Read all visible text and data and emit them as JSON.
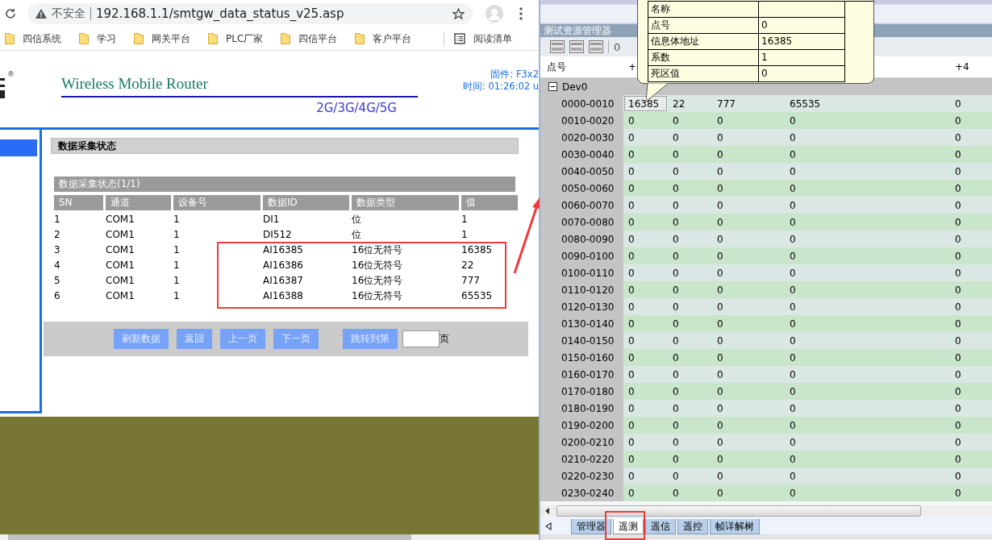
{
  "browser": {
    "security_label": "不安全",
    "url": "192.168.1.1/smtgw_data_status_v25.asp",
    "bookmarks": [
      "四信系统",
      "学习",
      "网关平台",
      "PLC厂家",
      "四信平台",
      "客户平台"
    ],
    "reading_list": "阅读清单"
  },
  "router_page": {
    "logo_mark": "®",
    "brand": "Wireless Mobile Router",
    "bands": "2G/3G/4G/5G",
    "firmware": "固件: F3x2",
    "time": "时间: 01:26:02 u",
    "section_title": "数据采集状态",
    "table_title": "数据采集状态(1/1)",
    "columns": [
      "SN",
      "通道",
      "设备号",
      "数据ID",
      "数据类型",
      "值"
    ],
    "rows": [
      [
        "1",
        "COM1",
        "1",
        "DI1",
        "位",
        "1"
      ],
      [
        "2",
        "COM1",
        "1",
        "DI512",
        "位",
        "1"
      ],
      [
        "3",
        "COM1",
        "1",
        "AI16385",
        "16位无符号",
        "16385"
      ],
      [
        "4",
        "COM1",
        "1",
        "AI16386",
        "16位无符号",
        "22"
      ],
      [
        "5",
        "COM1",
        "1",
        "AI16387",
        "16位无符号",
        "777"
      ],
      [
        "6",
        "COM1",
        "1",
        "AI16388",
        "16位无符号",
        "65535"
      ]
    ],
    "buttons": [
      "刷新数据",
      "返回",
      "上一页",
      "下一页",
      "跳转到第"
    ],
    "page_suffix": "页"
  },
  "tester": {
    "panel_title": "测试资源管理器",
    "toolbar_text": "0",
    "columns": [
      "点号",
      "+",
      "+4"
    ],
    "group": "Dev0",
    "rows": [
      {
        "range": "0000-0010",
        "values": [
          "16385",
          "22",
          "777",
          "65535",
          "0"
        ],
        "focused": true
      },
      {
        "range": "0010-0020",
        "values": [
          "0",
          "0",
          "0",
          "0",
          "0"
        ],
        "focused": false
      },
      {
        "range": "0020-0030",
        "values": [
          "0",
          "0",
          "0",
          "0",
          "0"
        ],
        "focused": false
      },
      {
        "range": "0030-0040",
        "values": [
          "0",
          "0",
          "0",
          "0",
          "0"
        ],
        "focused": false
      },
      {
        "range": "0040-0050",
        "values": [
          "0",
          "0",
          "0",
          "0",
          "0"
        ],
        "focused": false
      },
      {
        "range": "0050-0060",
        "values": [
          "0",
          "0",
          "0",
          "0",
          "0"
        ],
        "focused": false
      },
      {
        "range": "0060-0070",
        "values": [
          "0",
          "0",
          "0",
          "0",
          "0"
        ],
        "focused": false
      },
      {
        "range": "0070-0080",
        "values": [
          "0",
          "0",
          "0",
          "0",
          "0"
        ],
        "focused": false
      },
      {
        "range": "0080-0090",
        "values": [
          "0",
          "0",
          "0",
          "0",
          "0"
        ],
        "focused": false
      },
      {
        "range": "0090-0100",
        "values": [
          "0",
          "0",
          "0",
          "0",
          "0"
        ],
        "focused": false
      },
      {
        "range": "0100-0110",
        "values": [
          "0",
          "0",
          "0",
          "0",
          "0"
        ],
        "focused": false
      },
      {
        "range": "0110-0120",
        "values": [
          "0",
          "0",
          "0",
          "0",
          "0"
        ],
        "focused": false
      },
      {
        "range": "0120-0130",
        "values": [
          "0",
          "0",
          "0",
          "0",
          "0"
        ],
        "focused": false
      },
      {
        "range": "0130-0140",
        "values": [
          "0",
          "0",
          "0",
          "0",
          "0"
        ],
        "focused": false
      },
      {
        "range": "0140-0150",
        "values": [
          "0",
          "0",
          "0",
          "0",
          "0"
        ],
        "focused": false
      },
      {
        "range": "0150-0160",
        "values": [
          "0",
          "0",
          "0",
          "0",
          "0"
        ],
        "focused": false
      },
      {
        "range": "0160-0170",
        "values": [
          "0",
          "0",
          "0",
          "0",
          "0"
        ],
        "focused": false
      },
      {
        "range": "0170-0180",
        "values": [
          "0",
          "0",
          "0",
          "0",
          "0"
        ],
        "focused": false
      },
      {
        "range": "0180-0190",
        "values": [
          "0",
          "0",
          "0",
          "0",
          "0"
        ],
        "focused": false
      },
      {
        "range": "0190-0200",
        "values": [
          "0",
          "0",
          "0",
          "0",
          "0"
        ],
        "focused": false
      },
      {
        "range": "0200-0210",
        "values": [
          "0",
          "0",
          "0",
          "0",
          "0"
        ],
        "focused": false
      },
      {
        "range": "0210-0220",
        "values": [
          "0",
          "0",
          "0",
          "0",
          "0"
        ],
        "focused": false
      },
      {
        "range": "0220-0230",
        "values": [
          "0",
          "0",
          "0",
          "0",
          "0"
        ],
        "focused": false
      },
      {
        "range": "0230-0240",
        "values": [
          "0",
          "0",
          "0",
          "0",
          "0"
        ],
        "focused": false
      }
    ],
    "tooltip": [
      {
        "label": "名称"
      },
      {
        "label": "点号",
        "value": "0"
      },
      {
        "label": "信息体地址",
        "value": "16385"
      },
      {
        "label": "系数",
        "value": "1"
      },
      {
        "label": "死区值",
        "value": "0"
      }
    ],
    "tabs": [
      {
        "label": "管理器",
        "selected": false
      },
      {
        "label": "遥测",
        "selected": true
      },
      {
        "label": "遥信",
        "selected": false
      },
      {
        "label": "遥控",
        "selected": false
      },
      {
        "label": "帧详解树",
        "selected": false
      }
    ]
  }
}
